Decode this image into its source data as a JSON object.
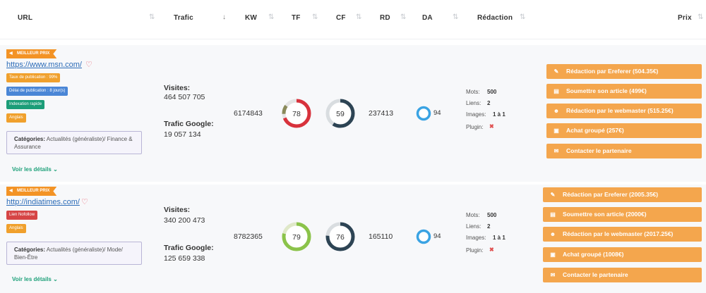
{
  "header": {
    "url": "URL",
    "trafic": "Trafic",
    "kw": "KW",
    "tf": "TF",
    "cf": "CF",
    "rd": "RD",
    "da": "DA",
    "redaction": "Rédaction",
    "prix": "Prix",
    "sort_icon": "⇅",
    "sort_active_icon": "↓"
  },
  "rows": [
    {
      "ribbon": "MEILLEUR PRIX",
      "url": "https://www.msn.com/",
      "badges": [
        "Taux de publication : 99%",
        "Délai de publication : 8 jour(s)",
        "Indexation rapide",
        "Anglais"
      ],
      "categories_label": "Catégories:",
      "categories": "Actualités (généraliste)/ Finance & Assurance",
      "details": "Voir les détails",
      "visites_label": "Visites:",
      "visites": "464 507 705",
      "trafic_label": "Trafic Google:",
      "trafic": "19 057 134",
      "kw": "6174843",
      "tf": 78,
      "cf": 59,
      "rd": "237413",
      "da": 94,
      "mots_label": "Mots:",
      "mots": "500",
      "liens_label": "Liens:",
      "liens": "2",
      "images_label": "Images:",
      "images": "1 à 1",
      "plugin_label": "Plugin:",
      "plugin": "✖",
      "buttons": [
        "Rédaction par Ereferer (504.35€)",
        "Soumettre son article (499€)",
        "Rédaction par le webmaster (515.25€)",
        "Achat groupé (257€)",
        "Contacter le partenaire"
      ]
    },
    {
      "ribbon": "MEILLEUR PRIX",
      "url": "http://indiatimes.com/",
      "badges": [
        "Lien Nofollow",
        "Anglais"
      ],
      "categories_label": "Catégories:",
      "categories": "Actualités (généraliste)/ Mode/ Bien-Être",
      "details": "Voir les détails",
      "visites_label": "Visites:",
      "visites": "340 200 473",
      "trafic_label": "Trafic Google:",
      "trafic": "125 659 338",
      "kw": "8782365",
      "tf": 79,
      "cf": 76,
      "rd": "165110",
      "da": 94,
      "mots_label": "Mots:",
      "mots": "500",
      "liens_label": "Liens:",
      "liens": "2",
      "images_label": "Images:",
      "images": "1 à 1",
      "plugin_label": "Plugin:",
      "plugin": "✖",
      "buttons": [
        "Rédaction par Ereferer (2005.35€)",
        "Soumettre son article (2000€)",
        "Rédaction par le webmaster (2017.25€)",
        "Achat groupé (1008€)",
        "Contacter le partenaire"
      ]
    }
  ],
  "colors": {
    "ribbon": "#f39325",
    "button": "#f4a64d",
    "link": "#2b6bb7",
    "details": "#1fa17a",
    "tf_ring_1": "#d8323c",
    "tf_ring_2": "#8bc34a",
    "cf_ring": "#2d4454",
    "da_ring": "#3aa3e3"
  },
  "icons": {
    "ribbon_icon": "left-arrow-icon",
    "heart": "heart-icon",
    "chevron": "chevron-down-icon",
    "buttons": [
      "pencil-icon",
      "document-icon",
      "user-icon",
      "basket-icon",
      "message-icon"
    ]
  }
}
